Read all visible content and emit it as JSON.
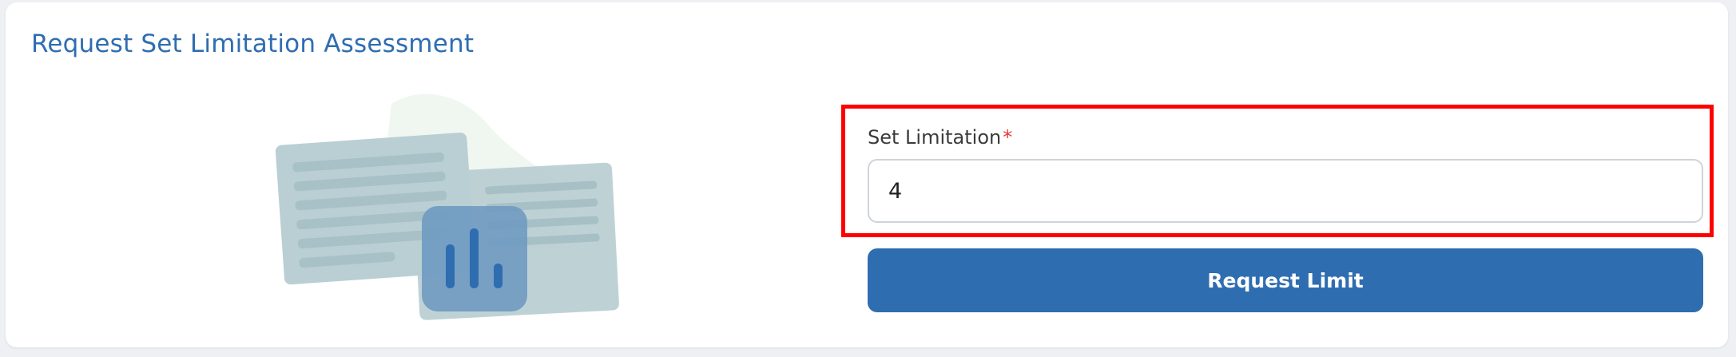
{
  "card": {
    "title": "Request Set Limitation Assessment"
  },
  "form": {
    "label": "Set Limitation",
    "required_marker": "*",
    "input_value": "4",
    "submit_label": "Request Limit"
  },
  "illustration": {
    "icon": "bar-chart-icon"
  },
  "colors": {
    "accent": "#2f6db1",
    "required": "#e53935",
    "highlight": "#ff0000",
    "card_background": "#ffffff",
    "page_background": "#eef0f3"
  }
}
